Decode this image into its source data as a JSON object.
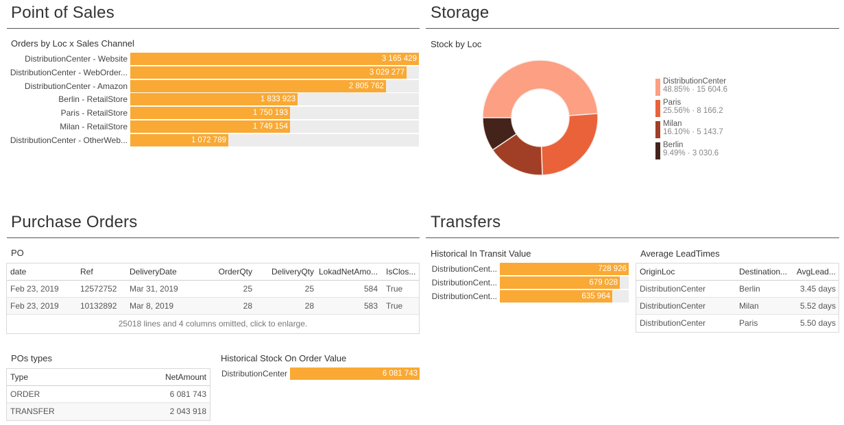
{
  "sections": {
    "point_of_sales": "Point of Sales",
    "storage": "Storage",
    "purchase_orders": "Purchase Orders",
    "transfers": "Transfers"
  },
  "colors": {
    "bar": "#f9a934",
    "track": "#ececec",
    "donut": [
      "#fc9f82",
      "#e9623a",
      "#a03f25",
      "#44231b"
    ]
  },
  "orders_by_loc": {
    "title": "Orders by Loc x Sales Channel",
    "max": 3165429,
    "items": [
      {
        "label": "DistributionCenter - Website",
        "value": 3165429,
        "display": "3 165 429"
      },
      {
        "label": "DistributionCenter - WebOrder...",
        "value": 3029277,
        "display": "3 029 277"
      },
      {
        "label": "DistributionCenter - Amazon",
        "value": 2805762,
        "display": "2 805 762"
      },
      {
        "label": "Berlin - RetailStore",
        "value": 1833923,
        "display": "1 833 923"
      },
      {
        "label": "Paris - RetailStore",
        "value": 1750193,
        "display": "1 750 193"
      },
      {
        "label": "Milan - RetailStore",
        "value": 1749154,
        "display": "1 749 154"
      },
      {
        "label": "DistributionCenter - OtherWeb...",
        "value": 1072789,
        "display": "1 072 789"
      }
    ]
  },
  "stock_by_loc": {
    "title": "Stock by Loc",
    "items": [
      {
        "label": "DistributionCenter",
        "pct": 48.85,
        "pct_display": "48.85%",
        "value": 15604.6,
        "display": "15 604.6"
      },
      {
        "label": "Paris",
        "pct": 25.56,
        "pct_display": "25.56%",
        "value": 8166.2,
        "display": "8 166.2"
      },
      {
        "label": "Milan",
        "pct": 16.1,
        "pct_display": "16.10%",
        "value": 5143.7,
        "display": "5 143.7"
      },
      {
        "label": "Berlin",
        "pct": 9.49,
        "pct_display": "9.49%",
        "value": 3030.6,
        "display": "3 030.6"
      }
    ],
    "separator": " · "
  },
  "po_table": {
    "title": "PO",
    "columns": [
      "date",
      "Ref",
      "DeliveryDate",
      "OrderQty",
      "DeliveryQty",
      "LokadNetAmo...",
      "IsClos..."
    ],
    "rows": [
      [
        "Feb 23, 2019",
        "12572752",
        "Mar 31, 2019",
        "25",
        "25",
        "584",
        "True"
      ],
      [
        "Feb 23, 2019",
        "10132892",
        "Mar 8, 2019",
        "28",
        "28",
        "583",
        "True"
      ]
    ],
    "footer": "25018 lines and 4 columns omitted, click to enlarge."
  },
  "pos_types": {
    "title": "POs types",
    "columns": [
      "Type",
      "NetAmount"
    ],
    "rows": [
      [
        "ORDER",
        "6 081 743"
      ],
      [
        "TRANSFER",
        "2 043 918"
      ]
    ]
  },
  "stock_on_order": {
    "title": "Historical Stock On Order Value",
    "max": 6081743,
    "items": [
      {
        "label": "DistributionCenter",
        "value": 6081743,
        "display": "6 081 743"
      }
    ]
  },
  "in_transit": {
    "title": "Historical In Transit Value",
    "max": 728926,
    "items": [
      {
        "label": "DistributionCent...",
        "value": 728926,
        "display": "728 926"
      },
      {
        "label": "DistributionCent...",
        "value": 679028,
        "display": "679 028"
      },
      {
        "label": "DistributionCent...",
        "value": 635964,
        "display": "635 964"
      }
    ]
  },
  "lead_times": {
    "title": "Average LeadTimes",
    "columns": [
      "OriginLoc",
      "Destination...",
      "AvgLead..."
    ],
    "rows": [
      [
        "DistributionCenter",
        "Berlin",
        "3.45 days"
      ],
      [
        "DistributionCenter",
        "Milan",
        "5.52 days"
      ],
      [
        "DistributionCenter",
        "Paris",
        "5.50 days"
      ]
    ]
  }
}
